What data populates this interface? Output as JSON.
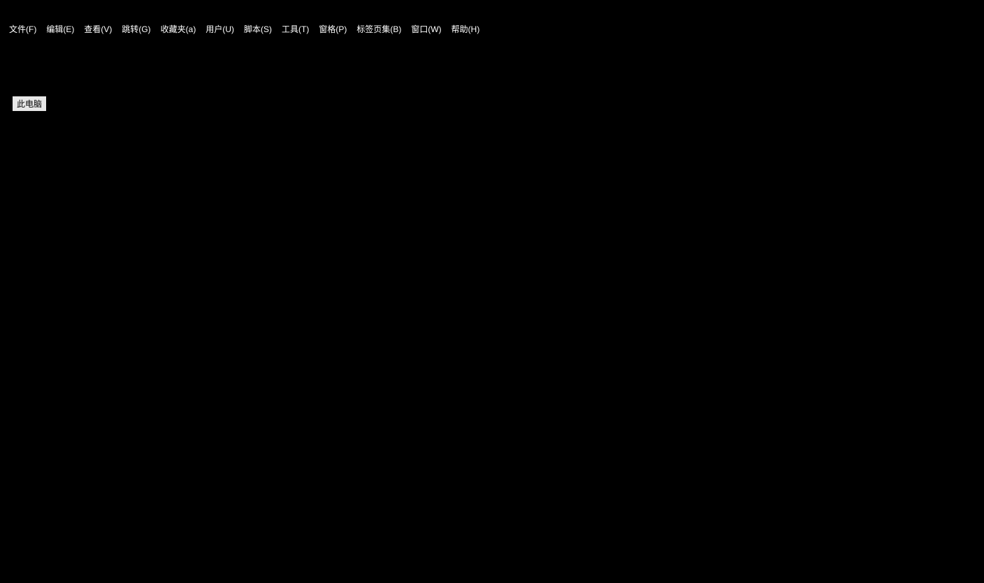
{
  "menubar": {
    "items": [
      {
        "label": "文件(F)"
      },
      {
        "label": "编辑(E)"
      },
      {
        "label": "查看(V)"
      },
      {
        "label": "跳转(G)"
      },
      {
        "label": "收藏夹(a)"
      },
      {
        "label": "用户(U)"
      },
      {
        "label": "脚本(S)"
      },
      {
        "label": "工具(T)"
      },
      {
        "label": "窗格(P)"
      },
      {
        "label": "标签页集(B)"
      },
      {
        "label": "窗口(W)"
      },
      {
        "label": "帮助(H)"
      }
    ]
  },
  "desktop": {
    "item_label": "此电脑"
  }
}
